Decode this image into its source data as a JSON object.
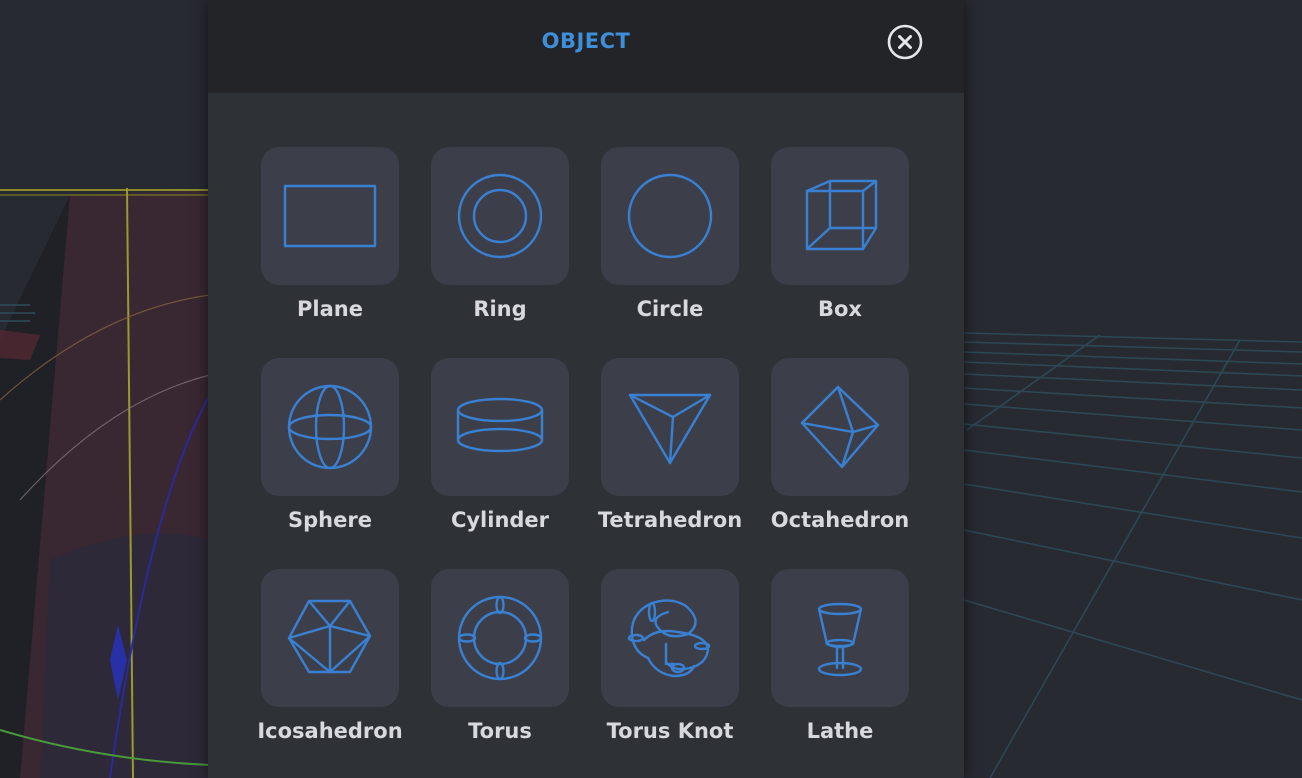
{
  "panel": {
    "title": "OBJECT",
    "close_icon": "close-circle-icon"
  },
  "objects": [
    {
      "label": "Plane",
      "icon": "plane-icon"
    },
    {
      "label": "Ring",
      "icon": "ring-icon"
    },
    {
      "label": "Circle",
      "icon": "circle-icon"
    },
    {
      "label": "Box",
      "icon": "box-icon"
    },
    {
      "label": "Sphere",
      "icon": "sphere-icon"
    },
    {
      "label": "Cylinder",
      "icon": "cylinder-icon"
    },
    {
      "label": "Tetrahedron",
      "icon": "tetrahedron-icon"
    },
    {
      "label": "Octahedron",
      "icon": "octahedron-icon"
    },
    {
      "label": "Icosahedron",
      "icon": "icosahedron-icon"
    },
    {
      "label": "Torus",
      "icon": "torus-icon"
    },
    {
      "label": "Torus Knot",
      "icon": "torus-knot-icon"
    },
    {
      "label": "Lathe",
      "icon": "lathe-icon"
    }
  ],
  "colors": {
    "accent": "#3e8ed8",
    "icon_stroke": "#3a80d2",
    "tile_bg": "#3c3f4a",
    "panel_bg": "#2e3136",
    "header_bg": "#232427",
    "label_text": "#d7d9de"
  }
}
